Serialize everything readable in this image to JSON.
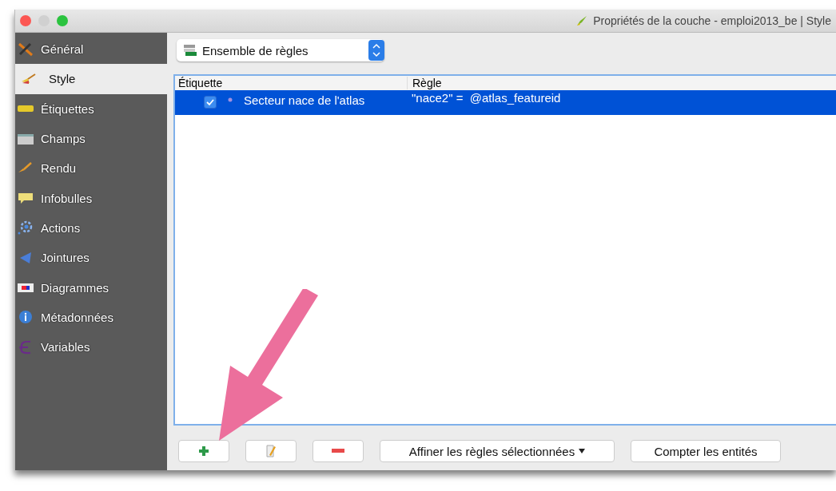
{
  "window": {
    "title": "Propriétés de la couche - emploi2013_be | Style"
  },
  "sidebar": {
    "items": [
      {
        "label": "Général",
        "selected": false
      },
      {
        "label": "Style",
        "selected": true
      },
      {
        "label": "Étiquettes",
        "selected": false
      },
      {
        "label": "Champs",
        "selected": false
      },
      {
        "label": "Rendu",
        "selected": false
      },
      {
        "label": "Infobulles",
        "selected": false
      },
      {
        "label": "Actions",
        "selected": false
      },
      {
        "label": "Jointures",
        "selected": false
      },
      {
        "label": "Diagrammes",
        "selected": false
      },
      {
        "label": "Métadonnées",
        "selected": false
      },
      {
        "label": "Variables",
        "selected": false
      }
    ]
  },
  "renderer": {
    "value": "Ensemble de règles"
  },
  "table": {
    "columns": [
      "Étiquette",
      "Règle"
    ],
    "rows": [
      {
        "checked": true,
        "selected": true,
        "label": "Secteur nace de l'atlas",
        "rule": "\"nace2\" =  @atlas_featureid"
      }
    ]
  },
  "buttons": [
    {
      "kind": "add"
    },
    {
      "kind": "edit"
    },
    {
      "kind": "remove"
    },
    {
      "kind": "menu",
      "label": "Affiner les règles sélectionnées"
    },
    {
      "kind": "text",
      "label": "Compter les entités"
    }
  ]
}
